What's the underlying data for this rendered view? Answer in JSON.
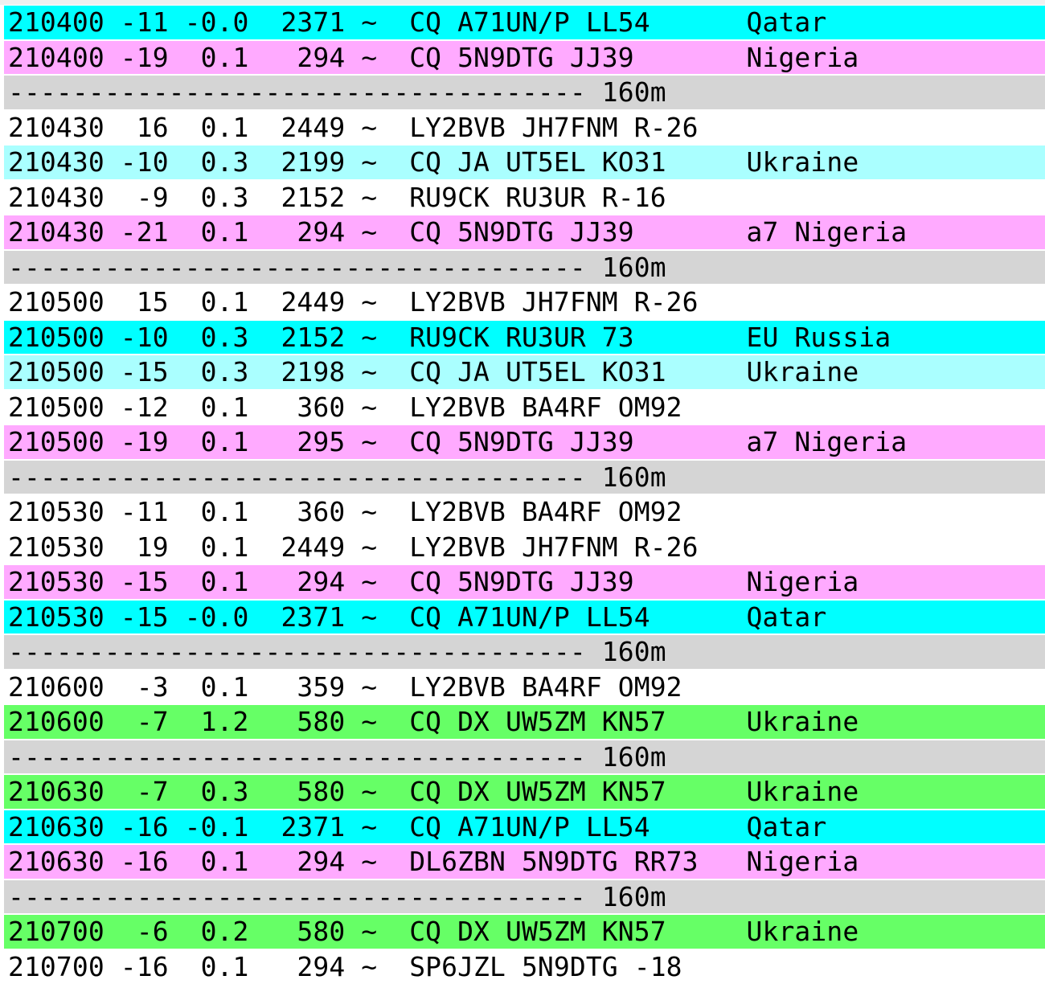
{
  "colors": {
    "cyan": "#00FFFF",
    "lightcyan": "#AAFFFF",
    "magenta": "#FFAAFF",
    "green": "#66FF66",
    "gray": "#D5D5D5",
    "none": "transparent",
    "text": "#000000",
    "top_strip": "#F0F0F0"
  },
  "band_label": "160m",
  "mode_symbol": "~",
  "rows": [
    {
      "type": "decode",
      "time": "210400",
      "snr": "-11",
      "dt": "-0.0",
      "freq": "2371",
      "mode": "~",
      "message": "CQ A71UN/P LL54",
      "country": "Qatar",
      "highlight": "cyan",
      "text": "210400 -11 -0.0  2371 ~  CQ A71UN/P LL54      Qatar"
    },
    {
      "type": "decode",
      "time": "210400",
      "snr": "-19",
      "dt": "0.1",
      "freq": "294",
      "mode": "~",
      "message": "CQ 5N9DTG JJ39",
      "country": "Nigeria",
      "highlight": "magenta",
      "text": "210400 -19  0.1   294 ~  CQ 5N9DTG JJ39       Nigeria"
    },
    {
      "type": "separator",
      "band": "160m",
      "highlight": "gray",
      "text": "------------------------------------ 160m"
    },
    {
      "type": "decode",
      "time": "210430",
      "snr": "16",
      "dt": "0.1",
      "freq": "2449",
      "mode": "~",
      "message": "LY2BVB JH7FNM R-26",
      "country": "",
      "highlight": "none",
      "text": "210430  16  0.1  2449 ~  LY2BVB JH7FNM R-26"
    },
    {
      "type": "decode",
      "time": "210430",
      "snr": "-10",
      "dt": "0.3",
      "freq": "2199",
      "mode": "~",
      "message": "CQ JA UT5EL KO31",
      "country": "Ukraine",
      "highlight": "lightcyan",
      "text": "210430 -10  0.3  2199 ~  CQ JA UT5EL KO31     Ukraine"
    },
    {
      "type": "decode",
      "time": "210430",
      "snr": "-9",
      "dt": "0.3",
      "freq": "2152",
      "mode": "~",
      "message": "RU9CK RU3UR R-16",
      "country": "",
      "highlight": "none",
      "text": "210430  -9  0.3  2152 ~  RU9CK RU3UR R-16"
    },
    {
      "type": "decode",
      "time": "210430",
      "snr": "-21",
      "dt": "0.1",
      "freq": "294",
      "mode": "~",
      "message": "CQ 5N9DTG JJ39",
      "country": "a7 Nigeria",
      "highlight": "magenta",
      "text": "210430 -21  0.1   294 ~  CQ 5N9DTG JJ39       a7 Nigeria"
    },
    {
      "type": "separator",
      "band": "160m",
      "highlight": "gray",
      "text": "------------------------------------ 160m"
    },
    {
      "type": "decode",
      "time": "210500",
      "snr": "15",
      "dt": "0.1",
      "freq": "2449",
      "mode": "~",
      "message": "LY2BVB JH7FNM R-26",
      "country": "",
      "highlight": "none",
      "text": "210500  15  0.1  2449 ~  LY2BVB JH7FNM R-26"
    },
    {
      "type": "decode",
      "time": "210500",
      "snr": "-10",
      "dt": "0.3",
      "freq": "2152",
      "mode": "~",
      "message": "RU9CK RU3UR 73",
      "country": "EU Russia",
      "highlight": "cyan",
      "text": "210500 -10  0.3  2152 ~  RU9CK RU3UR 73       EU Russia"
    },
    {
      "type": "decode",
      "time": "210500",
      "snr": "-15",
      "dt": "0.3",
      "freq": "2198",
      "mode": "~",
      "message": "CQ JA UT5EL KO31",
      "country": "Ukraine",
      "highlight": "lightcyan",
      "text": "210500 -15  0.3  2198 ~  CQ JA UT5EL KO31     Ukraine"
    },
    {
      "type": "decode",
      "time": "210500",
      "snr": "-12",
      "dt": "0.1",
      "freq": "360",
      "mode": "~",
      "message": "LY2BVB BA4RF OM92",
      "country": "",
      "highlight": "none",
      "text": "210500 -12  0.1   360 ~  LY2BVB BA4RF OM92"
    },
    {
      "type": "decode",
      "time": "210500",
      "snr": "-19",
      "dt": "0.1",
      "freq": "295",
      "mode": "~",
      "message": "CQ 5N9DTG JJ39",
      "country": "a7 Nigeria",
      "highlight": "magenta",
      "text": "210500 -19  0.1   295 ~  CQ 5N9DTG JJ39       a7 Nigeria"
    },
    {
      "type": "separator",
      "band": "160m",
      "highlight": "gray",
      "text": "------------------------------------ 160m"
    },
    {
      "type": "decode",
      "time": "210530",
      "snr": "-11",
      "dt": "0.1",
      "freq": "360",
      "mode": "~",
      "message": "LY2BVB BA4RF OM92",
      "country": "",
      "highlight": "none",
      "text": "210530 -11  0.1   360 ~  LY2BVB BA4RF OM92"
    },
    {
      "type": "decode",
      "time": "210530",
      "snr": "19",
      "dt": "0.1",
      "freq": "2449",
      "mode": "~",
      "message": "LY2BVB JH7FNM R-26",
      "country": "",
      "highlight": "none",
      "text": "210530  19  0.1  2449 ~  LY2BVB JH7FNM R-26"
    },
    {
      "type": "decode",
      "time": "210530",
      "snr": "-15",
      "dt": "0.1",
      "freq": "294",
      "mode": "~",
      "message": "CQ 5N9DTG JJ39",
      "country": "Nigeria",
      "highlight": "magenta",
      "text": "210530 -15  0.1   294 ~  CQ 5N9DTG JJ39       Nigeria"
    },
    {
      "type": "decode",
      "time": "210530",
      "snr": "-15",
      "dt": "-0.0",
      "freq": "2371",
      "mode": "~",
      "message": "CQ A71UN/P LL54",
      "country": "Qatar",
      "highlight": "cyan",
      "text": "210530 -15 -0.0  2371 ~  CQ A71UN/P LL54      Qatar"
    },
    {
      "type": "separator",
      "band": "160m",
      "highlight": "gray",
      "text": "------------------------------------ 160m"
    },
    {
      "type": "decode",
      "time": "210600",
      "snr": "-3",
      "dt": "0.1",
      "freq": "359",
      "mode": "~",
      "message": "LY2BVB BA4RF OM92",
      "country": "",
      "highlight": "none",
      "text": "210600  -3  0.1   359 ~  LY2BVB BA4RF OM92"
    },
    {
      "type": "decode",
      "time": "210600",
      "snr": "-7",
      "dt": "1.2",
      "freq": "580",
      "mode": "~",
      "message": "CQ DX UW5ZM KN57",
      "country": "Ukraine",
      "highlight": "green",
      "text": "210600  -7  1.2   580 ~  CQ DX UW5ZM KN57     Ukraine"
    },
    {
      "type": "separator",
      "band": "160m",
      "highlight": "gray",
      "text": "------------------------------------ 160m"
    },
    {
      "type": "decode",
      "time": "210630",
      "snr": "-7",
      "dt": "0.3",
      "freq": "580",
      "mode": "~",
      "message": "CQ DX UW5ZM KN57",
      "country": "Ukraine",
      "highlight": "green",
      "text": "210630  -7  0.3   580 ~  CQ DX UW5ZM KN57     Ukraine"
    },
    {
      "type": "decode",
      "time": "210630",
      "snr": "-16",
      "dt": "-0.1",
      "freq": "2371",
      "mode": "~",
      "message": "CQ A71UN/P LL54",
      "country": "Qatar",
      "highlight": "cyan",
      "text": "210630 -16 -0.1  2371 ~  CQ A71UN/P LL54      Qatar"
    },
    {
      "type": "decode",
      "time": "210630",
      "snr": "-16",
      "dt": "0.1",
      "freq": "294",
      "mode": "~",
      "message": "DL6ZBN 5N9DTG RR73",
      "country": "Nigeria",
      "highlight": "magenta",
      "text": "210630 -16  0.1   294 ~  DL6ZBN 5N9DTG RR73   Nigeria"
    },
    {
      "type": "separator",
      "band": "160m",
      "highlight": "gray",
      "text": "------------------------------------ 160m"
    },
    {
      "type": "decode",
      "time": "210700",
      "snr": "-6",
      "dt": "0.2",
      "freq": "580",
      "mode": "~",
      "message": "CQ DX UW5ZM KN57",
      "country": "Ukraine",
      "highlight": "green",
      "text": "210700  -6  0.2   580 ~  CQ DX UW5ZM KN57     Ukraine"
    },
    {
      "type": "decode",
      "time": "210700",
      "snr": "-16",
      "dt": "0.1",
      "freq": "294",
      "mode": "~",
      "message": "SP6JZL 5N9DTG -18",
      "country": "",
      "highlight": "none",
      "text": "210700 -16  0.1   294 ~  SP6JZL 5N9DTG -18"
    }
  ]
}
